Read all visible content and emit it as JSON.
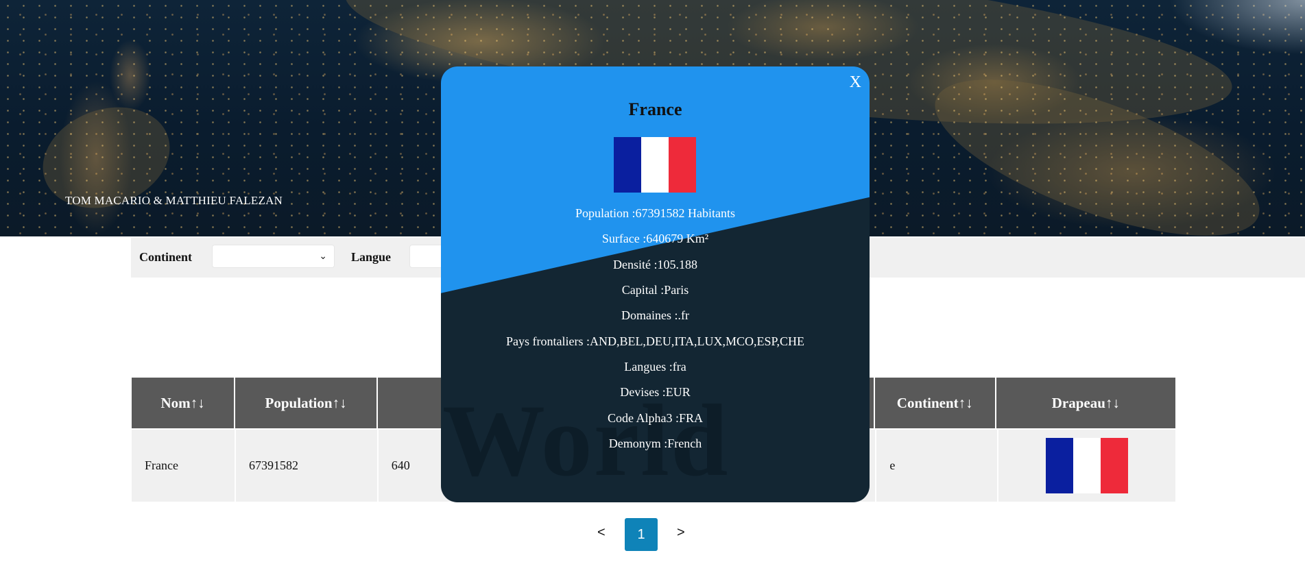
{
  "header": {
    "authors": "TOM MACARIO & MATTHIEU FALEZAN"
  },
  "filters": {
    "continent_label": "Continent",
    "continent_value": "",
    "langue_label": "Langue",
    "langue_value": ""
  },
  "table": {
    "columns": [
      "Nom↑↓",
      "Population↑↓",
      "",
      "",
      "",
      "",
      "Continent↑↓",
      "Drapeau↑↓"
    ],
    "rows": [
      {
        "nom": "France",
        "population": "67391582",
        "surface_partial": "640",
        "continent_partial": "e",
        "flag_icon": "france-flag"
      }
    ]
  },
  "pagination": {
    "prev": "<",
    "current": "1",
    "next": ">"
  },
  "modal": {
    "close": "X",
    "title": "France",
    "flag_icon": "france-flag",
    "population": "Population :67391582 Habitants",
    "surface": "Surface :640679 Km²",
    "densite": "Densité :105.188",
    "capital": "Capital :Paris",
    "domaines": "Domaines :.fr",
    "frontaliers": "Pays frontaliers :AND,BEL,DEU,ITA,LUX,MCO,ESP,CHE",
    "langues": "Langues :fra",
    "devises": "Devises :EUR",
    "alpha3": "Code Alpha3 :FRA",
    "demonym": "Demonym :French",
    "watermark": "World"
  },
  "colors": {
    "modal_blue": "#2093ee",
    "modal_dark": "#132633",
    "header_gray": "#595959",
    "page_accent": "#0f83b8",
    "flag_blue": "#0a1f9f",
    "flag_white": "#ffffff",
    "flag_red": "#ee2a3a"
  }
}
